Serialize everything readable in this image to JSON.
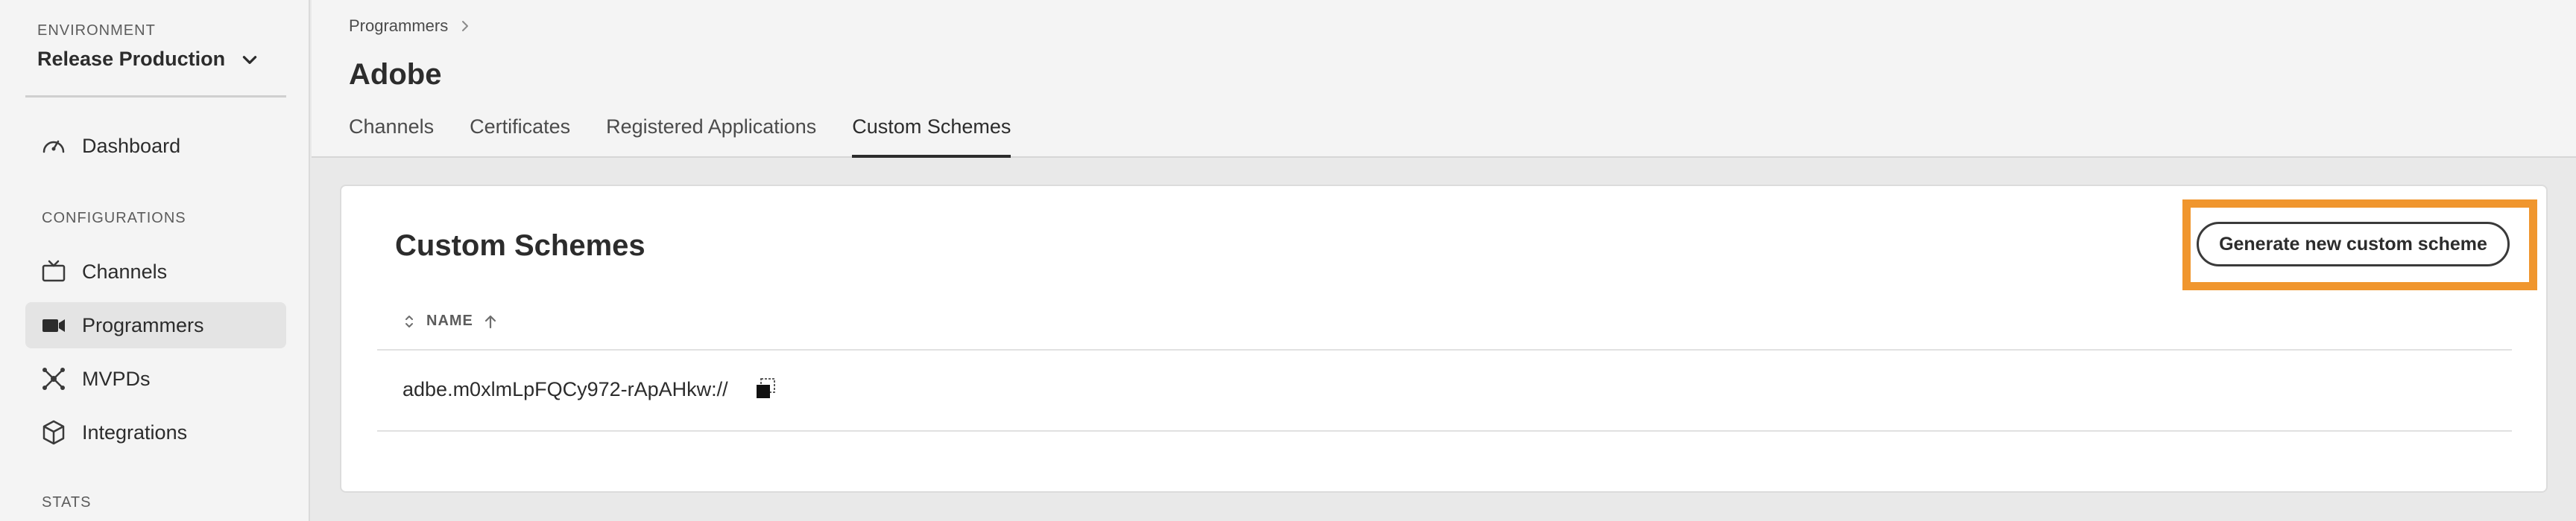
{
  "sidebar": {
    "environment_label": "ENVIRONMENT",
    "environment_value": "Release Production",
    "dashboard": "Dashboard",
    "configurations_label": "CONFIGURATIONS",
    "items": [
      {
        "label": "Channels",
        "icon": "tv-icon"
      },
      {
        "label": "Programmers",
        "icon": "video-camera-icon"
      },
      {
        "label": "MVPDs",
        "icon": "network-icon"
      },
      {
        "label": "Integrations",
        "icon": "cube-icon"
      }
    ],
    "stats_label": "STATS"
  },
  "header": {
    "breadcrumb": "Programmers",
    "title": "Adobe",
    "tabs": [
      {
        "label": "Channels"
      },
      {
        "label": "Certificates"
      },
      {
        "label": "Registered Applications"
      },
      {
        "label": "Custom Schemes"
      }
    ],
    "active_tab": "Custom Schemes"
  },
  "main": {
    "title": "Custom Schemes",
    "generate_button": "Generate new custom scheme",
    "table": {
      "columns": [
        "NAME"
      ],
      "rows": [
        {
          "name": "adbe.m0xlmLpFQCy972-rApAHkw://"
        }
      ]
    }
  },
  "colors": {
    "highlight": "#f0962e",
    "active_nav_bg": "#e4e4e4"
  }
}
